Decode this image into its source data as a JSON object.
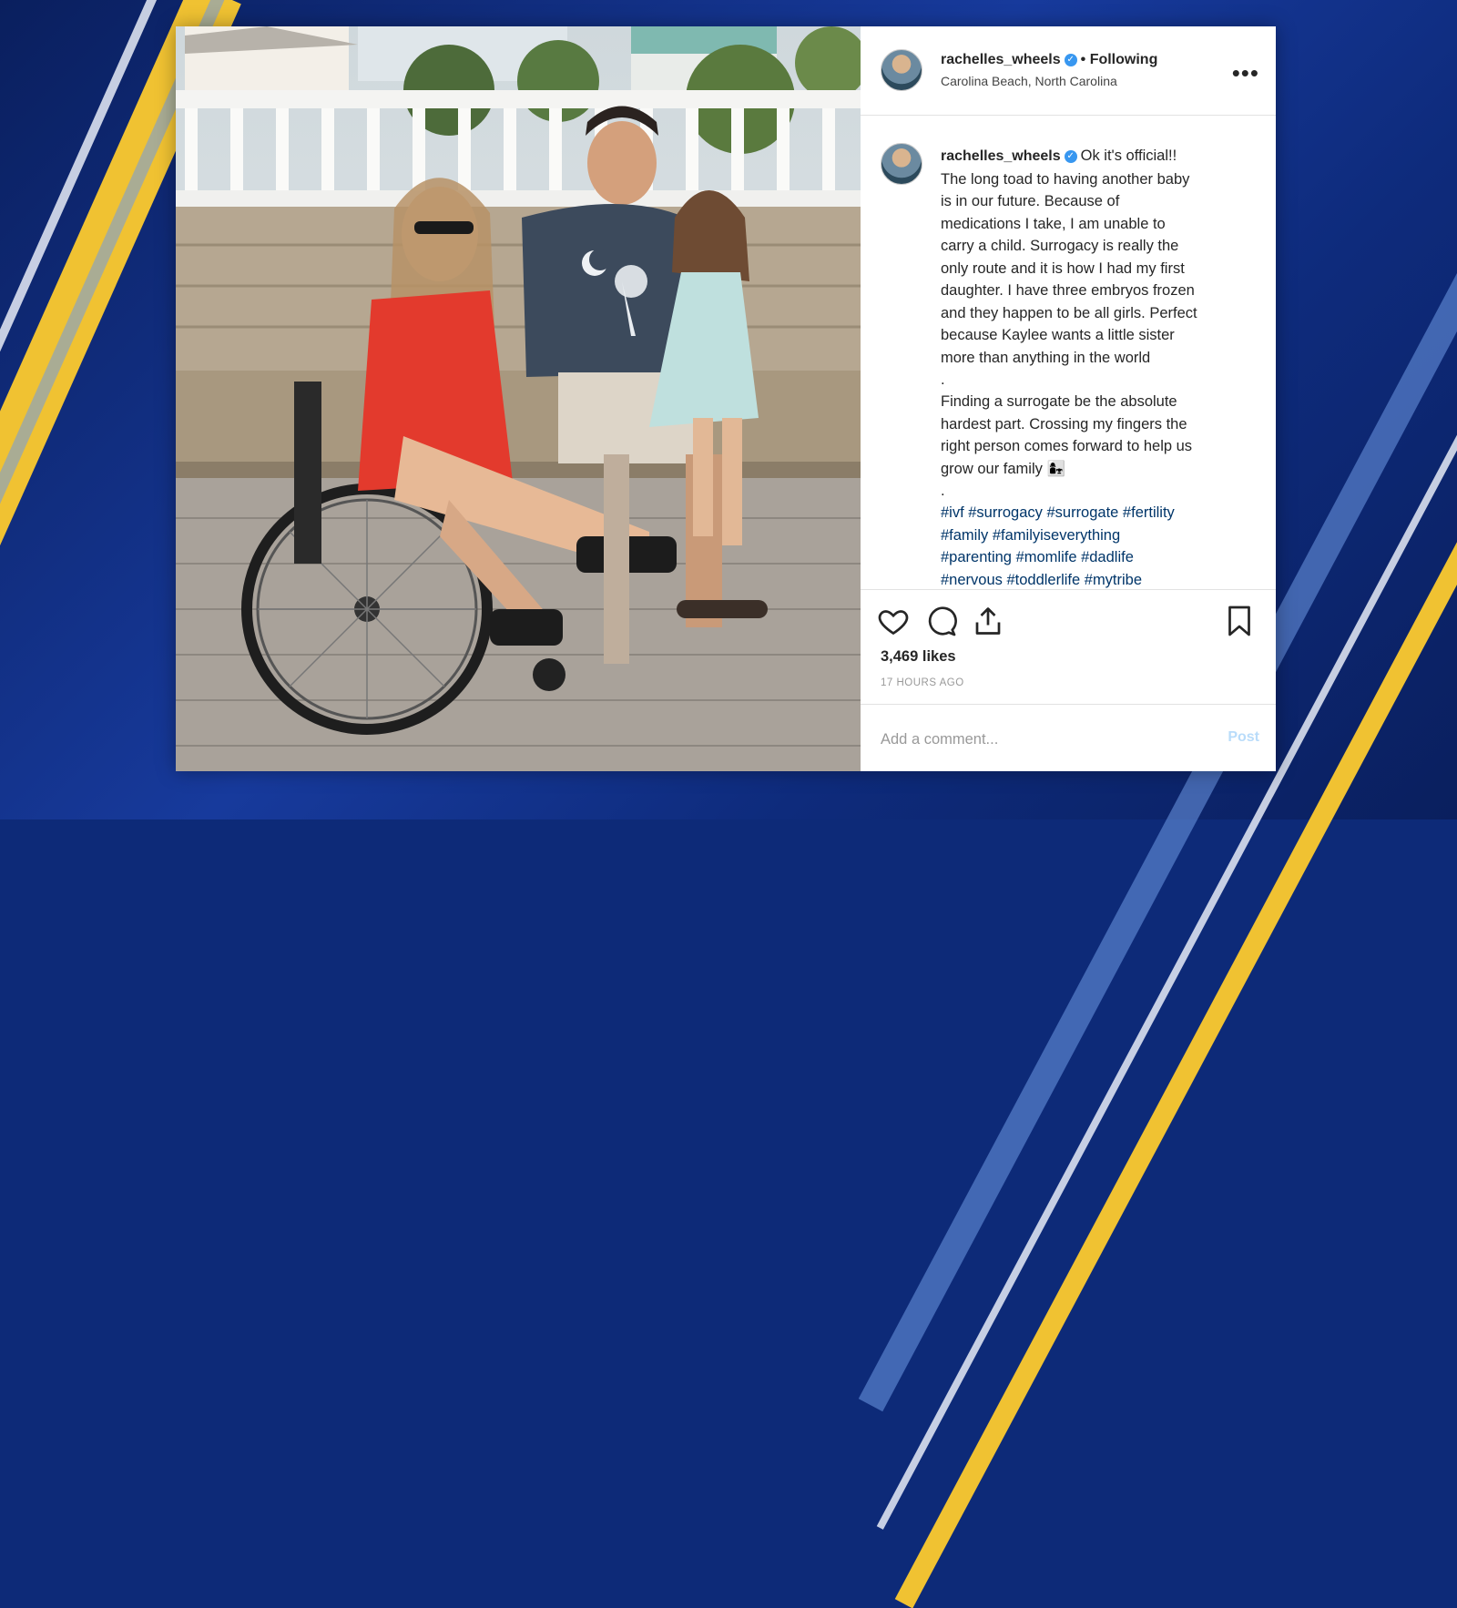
{
  "post": {
    "username": "rachelles_wheels",
    "follow_status": "Following",
    "location": "Carolina Beach, North Carolina",
    "more_icon": "more-dots-icon",
    "caption_lines_1": [
      "Ok it's official!!",
      "The long toad to having another baby",
      "is in our future. Because of",
      "medications I take, I am unable to",
      "carry a child. Surrogacy is really the",
      "only route and it is how I had my first",
      "daughter. I have three embryos frozen",
      "and they happen to be all girls. Perfect",
      "because Kaylee wants a little sister",
      "more than anything in the world"
    ],
    "separator": ".",
    "caption_lines_2": [
      "Finding a surrogate be the absolute",
      "hardest part. Crossing my fingers the",
      "right person comes forward to help us",
      "grow our family 👩‍👧"
    ],
    "hashtags_lines": [
      "#ivf #surrogacy #surrogate #fertility",
      "#family #familyiseverything",
      "#parenting #momlife #dadlife",
      "#nervous #toddlerlife #mytribe"
    ],
    "likes": "3,469 likes",
    "time_ago": "17 HOURS AGO",
    "comment_placeholder": "Add a comment...",
    "post_button": "Post"
  },
  "icons": [
    "heart-icon",
    "comment-icon",
    "share-icon",
    "bookmark-icon",
    "verified-badge-icon"
  ],
  "colors": {
    "verified": "#3897f0",
    "hashtag": "#003569",
    "post_button_disabled": "#b9dcfa",
    "broadcast_gold": "#f0c232",
    "broadcast_blue": "#173a9c"
  }
}
